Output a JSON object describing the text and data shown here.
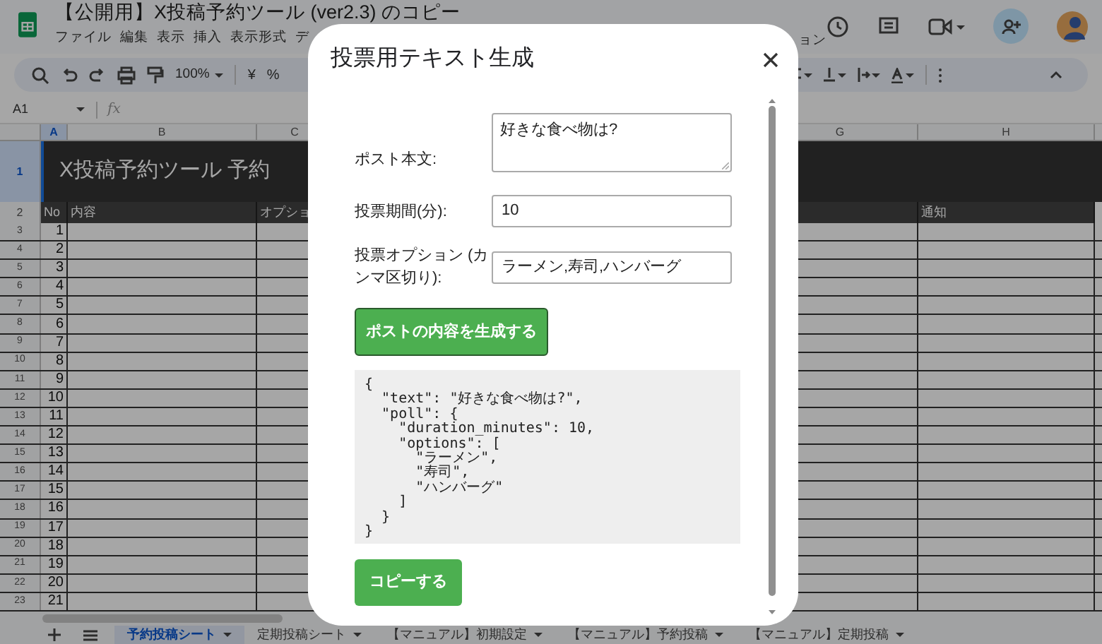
{
  "app": {
    "title": "【公開用】X投稿予約ツール (ver2.3) のコピー",
    "menu": [
      "ファイル",
      "編集",
      "表示",
      "挿入",
      "表示形式",
      "デ"
    ],
    "menu_right": "ョン",
    "zoom": "100%",
    "currency": "¥",
    "percent": "%",
    "cell_ref": "A1",
    "fx": "fx"
  },
  "sheet": {
    "columns": [
      {
        "label": "A",
        "selected": true,
        "header": "No"
      },
      {
        "label": "B",
        "selected": false,
        "header": "内容"
      },
      {
        "label": "C",
        "selected": false,
        "header": "オプショ"
      },
      {
        "label": "G",
        "selected": false
      },
      {
        "label": "H",
        "selected": false,
        "header": "通知"
      }
    ],
    "title_row": "X投稿予約ツール 予約",
    "row_numbers": [
      "1",
      "2",
      "3",
      "4",
      "5",
      "6",
      "7",
      "8",
      "9",
      "10",
      "11",
      "12",
      "13",
      "14",
      "15",
      "16",
      "17",
      "18",
      "19",
      "20",
      "21",
      "22",
      "23"
    ],
    "numbers": [
      "1",
      "2",
      "3",
      "4",
      "5",
      "6",
      "7",
      "8",
      "9",
      "10",
      "11",
      "12",
      "13",
      "14",
      "15",
      "16",
      "17",
      "18",
      "19",
      "20",
      "21"
    ]
  },
  "sheet_tabs": [
    {
      "label": "予約投稿シート",
      "selected": true
    },
    {
      "label": "定期投稿シート",
      "selected": false
    },
    {
      "label": "【マニュアル】初期設定",
      "selected": false
    },
    {
      "label": "【マニュアル】予約投稿",
      "selected": false
    },
    {
      "label": "【マニュアル】定期投稿",
      "selected": false
    }
  ],
  "dialog": {
    "title": "投票用テキスト生成",
    "fields": [
      {
        "kind": "textarea",
        "label": "ポスト本文:",
        "value": "好きな食べ物は?"
      },
      {
        "kind": "input",
        "label": "投票期間(分):",
        "value": "10"
      },
      {
        "kind": "input",
        "label": "投票オプション (カンマ区切り):",
        "value": "ラーメン,寿司,ハンバーグ"
      }
    ],
    "generate_button": "ポストの内容を生成する",
    "output": "{\n  \"text\": \"好きな食べ物は?\",\n  \"poll\": {\n    \"duration_minutes\": 10,\n    \"options\": [\n      \"ラーメン\",\n      \"寿司\",\n      \"ハンバーグ\"\n    ]\n  }\n}",
    "copy_button": "コピーする"
  }
}
